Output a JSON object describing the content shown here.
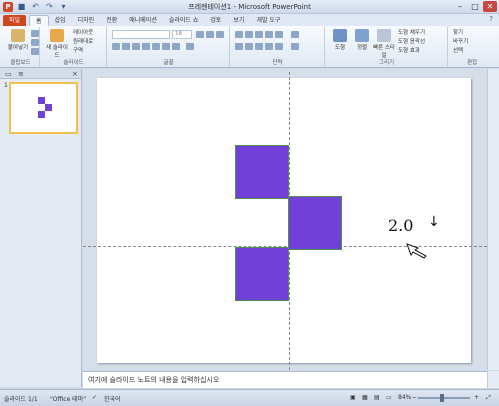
{
  "window": {
    "title": "프레젠테이션1 - Microsoft PowerPoint",
    "app_icon": "P"
  },
  "quick_access": [
    "save-icon",
    "undo-icon",
    "redo-icon",
    "customize-icon"
  ],
  "ribbon_tabs": [
    "파일",
    "홈",
    "삽입",
    "디자인",
    "전환",
    "애니메이션",
    "슬라이드 쇼",
    "검토",
    "보기",
    "개발 도구"
  ],
  "ribbon": {
    "clipboard": {
      "paste": "붙여넣기",
      "label": "클립보드"
    },
    "slides": {
      "new_slide": "새 슬라이드",
      "layout": "레이아웃",
      "reset": "원래대로",
      "section": "구역",
      "label": "슬라이드"
    },
    "font": {
      "font_name": "",
      "font_size": "18",
      "label": "글꼴"
    },
    "paragraph": {
      "label": "단락"
    },
    "drawing": {
      "shapes": "도형",
      "arrange": "정렬",
      "quick_styles": "빠른 스타일",
      "fill": "도형 채우기",
      "outline": "도형 윤곽선",
      "effects": "도형 효과",
      "label": "그리기"
    },
    "editing": {
      "find": "찾기",
      "replace": "바꾸기",
      "select": "선택",
      "label": "편집"
    }
  },
  "slide_pane": {
    "slide_number": "1"
  },
  "slide": {
    "value_label": "2.0",
    "arrow": "↓",
    "shape_color": "#7140d6"
  },
  "notes": {
    "placeholder": "여기에 슬라이드 노트의 내용을 입력하십시오"
  },
  "status": {
    "slide_info": "슬라이드 1/1",
    "theme": "\"Office 테마\"",
    "language": "한국어",
    "zoom": "84%"
  }
}
